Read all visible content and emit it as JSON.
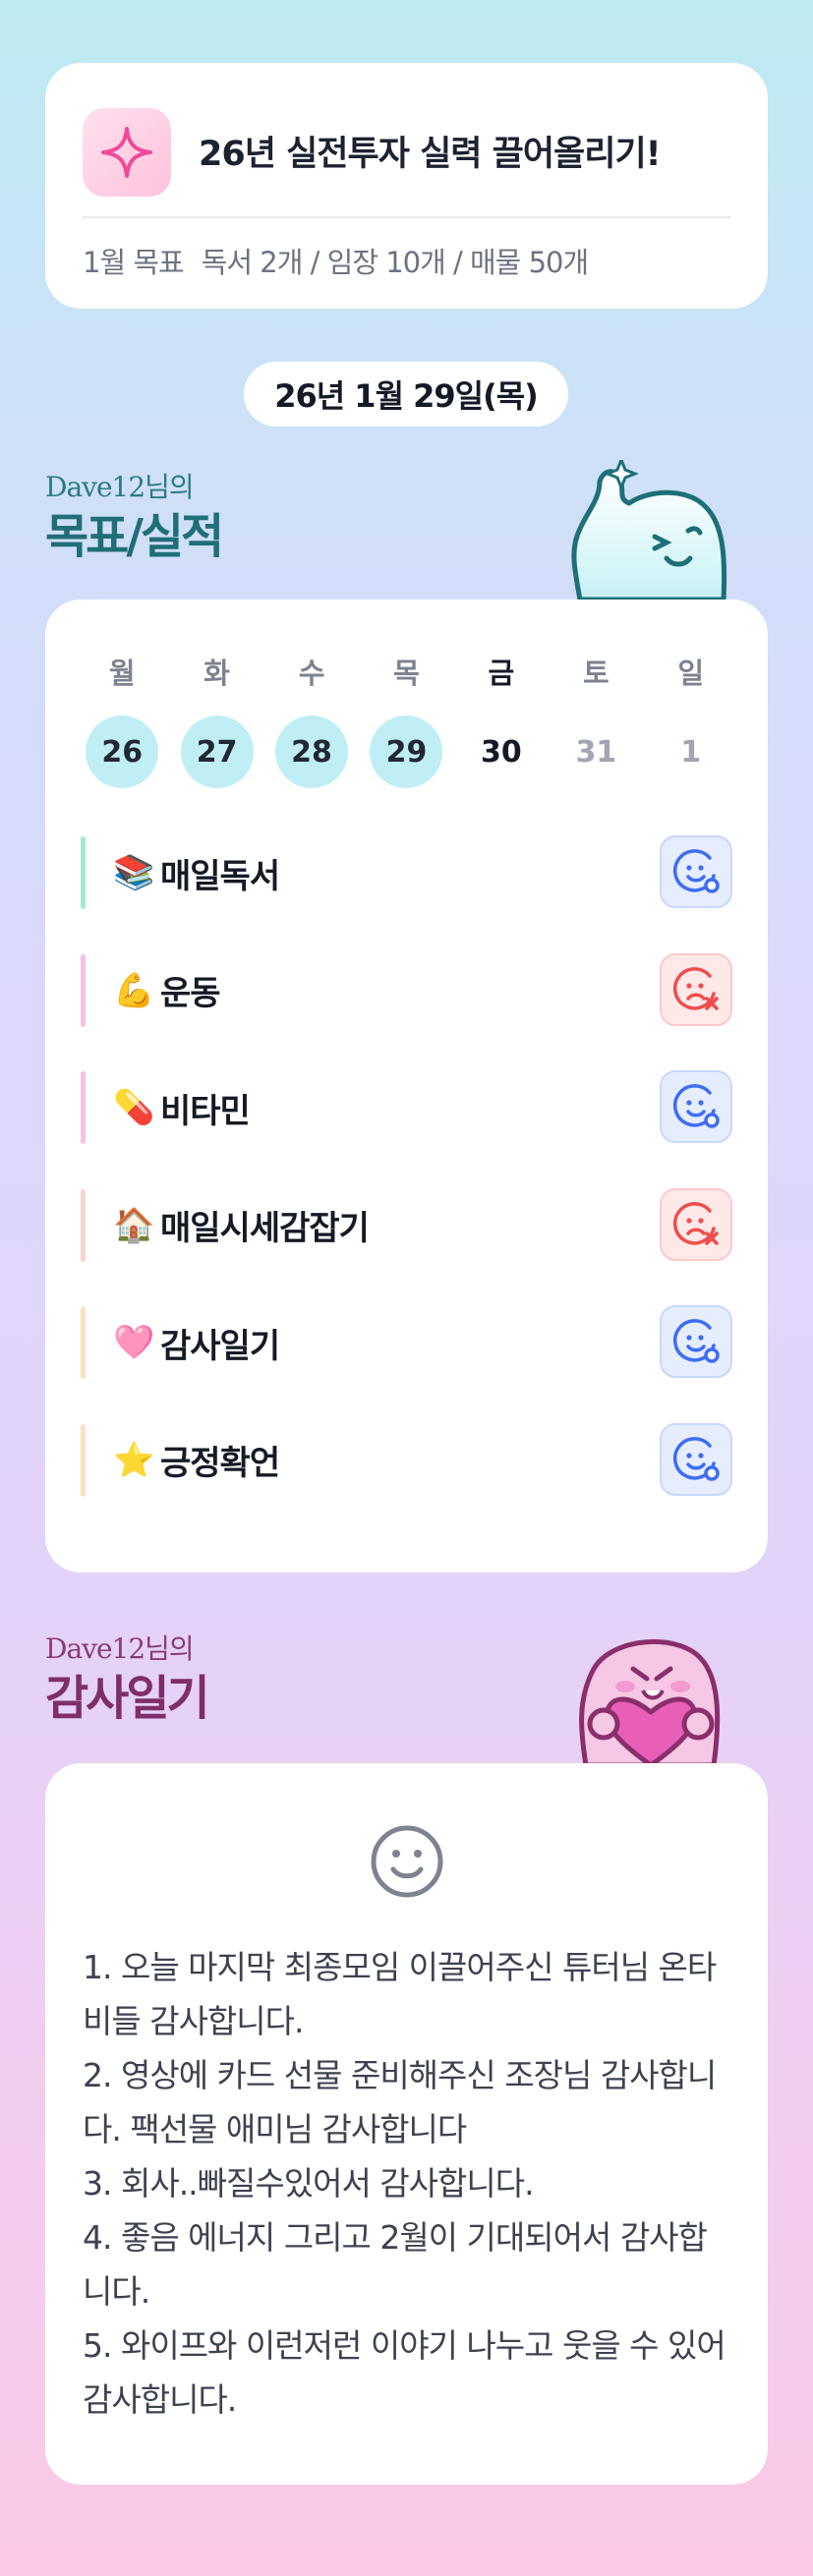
{
  "goal_card": {
    "title": "26년 실전투자 실력 끌어올리기!",
    "month_label": "1월 목표",
    "targets": "독서 2개 / 임장 10개 / 매물 50개"
  },
  "date_label": "26년 1월 29일(목)",
  "goals_section": {
    "owner": "Dave12님의",
    "title": "목표/실적",
    "weekdays": [
      "월",
      "화",
      "수",
      "목",
      "금",
      "토",
      "일"
    ],
    "days": [
      {
        "num": "26",
        "state": "done"
      },
      {
        "num": "27",
        "state": "done"
      },
      {
        "num": "28",
        "state": "done"
      },
      {
        "num": "29",
        "state": "done"
      },
      {
        "num": "30",
        "state": "today"
      },
      {
        "num": "31",
        "state": "future"
      },
      {
        "num": "1",
        "state": "future"
      }
    ],
    "habits": [
      {
        "emoji": "📚",
        "name": "매일독서",
        "status": "done",
        "bar_color": "#a6e8d6"
      },
      {
        "emoji": "💪",
        "name": "운동",
        "status": "missed",
        "bar_color": "#f7c2de"
      },
      {
        "emoji": "💊",
        "name": "비타민",
        "status": "done",
        "bar_color": "#f7c2de"
      },
      {
        "emoji": "🏠",
        "name": "매일시세감잡기",
        "status": "missed",
        "bar_color": "#fcd3cd"
      },
      {
        "emoji": "🩷",
        "name": "감사일기",
        "status": "done",
        "bar_color": "#fde0c4"
      },
      {
        "emoji": "⭐",
        "name": "긍정확언",
        "status": "done",
        "bar_color": "#fde0c4"
      }
    ]
  },
  "thanks_section": {
    "owner": "Dave12님의",
    "title": "감사일기",
    "entries": [
      "1. 오늘 마지막 최종모임 이끌어주신 튜터님 온타비들 감사합니다.",
      "2. 영상에 카드 선물 준비해주신 조장님 감사합니다. 팩선물 애미님 감사합니다",
      "3. 회사..빠질수있어서 감사합니다.",
      "4. 좋음 에너지 그리고 2월이 기대되어서 감사합니다.",
      "5. 와이프와 이런저런 이야기 나누고 웃을 수 있어 감사합니다."
    ]
  },
  "colors": {
    "done_day": "#bfeff4",
    "status_ok": "#3d6df2",
    "status_missed": "#ef4d4d"
  }
}
